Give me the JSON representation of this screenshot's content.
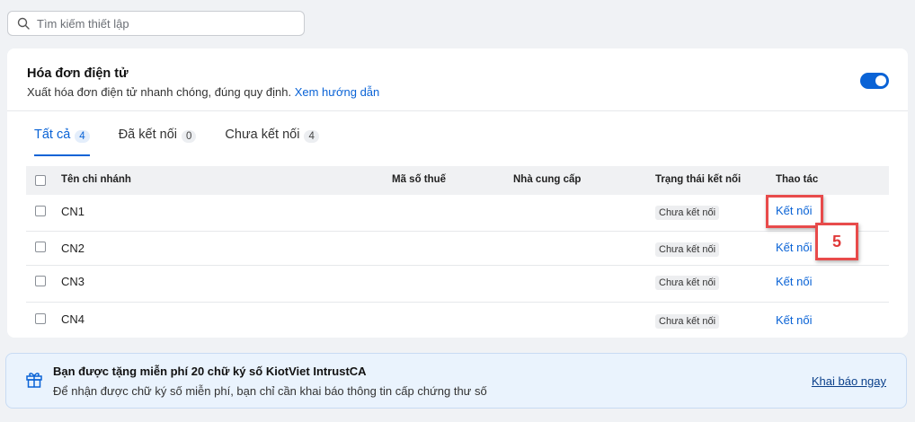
{
  "search": {
    "placeholder": "Tìm kiếm thiết lập"
  },
  "card": {
    "title": "Hóa đơn điện tử",
    "description": "Xuất hóa đơn điện tử nhanh chóng, đúng quy định.",
    "guide_link": "Xem hướng dẫn",
    "toggle_on": true
  },
  "tabs": [
    {
      "label": "Tất cả",
      "count": "4"
    },
    {
      "label": "Đã kết nối",
      "count": "0"
    },
    {
      "label": "Chưa kết nối",
      "count": "4"
    }
  ],
  "table": {
    "headers": {
      "name": "Tên chi nhánh",
      "tax": "Mã số thuế",
      "provider": "Nhà cung cấp",
      "status": "Trạng thái kết nối",
      "action": "Thao tác"
    },
    "rows": [
      {
        "name": "CN1",
        "tax": "",
        "provider": "",
        "status": "Chưa kết nối",
        "action": "Kết nối"
      },
      {
        "name": "CN2",
        "tax": "",
        "provider": "",
        "status": "Chưa kết nối",
        "action": "Kết nối"
      },
      {
        "name": "CN3",
        "tax": "",
        "provider": "",
        "status": "Chưa kết nối",
        "action": "Kết nối"
      },
      {
        "name": "CN4",
        "tax": "",
        "provider": "",
        "status": "Chưa kết nối",
        "action": "Kết nối"
      }
    ]
  },
  "annotation": {
    "step": "5"
  },
  "promo": {
    "title": "Bạn được tặng miễn phí 20 chữ ký số KiotViet IntrustCA",
    "description": "Để nhận được chữ ký số miễn phí, bạn chỉ cần khai báo thông tin cấp chứng thư số",
    "link": "Khai báo ngay"
  },
  "colors": {
    "accent": "#0a63d6",
    "highlight": "#e84b4b",
    "promo_bg": "#eaf3fd"
  },
  "icons": {
    "search": "search-icon",
    "gift": "gift-icon"
  }
}
